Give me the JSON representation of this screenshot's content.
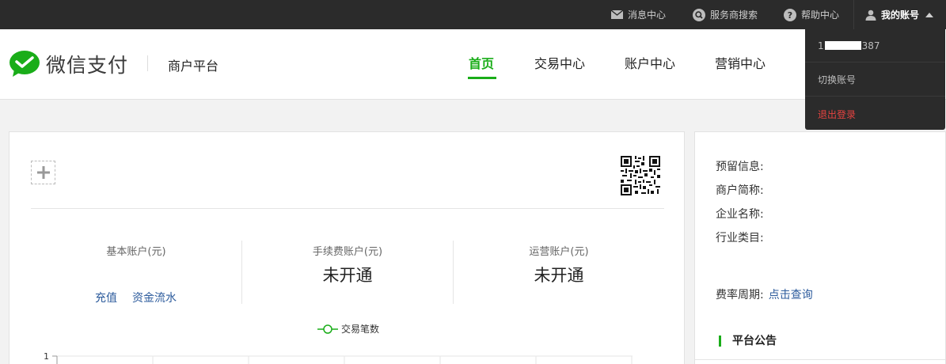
{
  "topbar": {
    "messages": "消息中心",
    "provider_search": "服务商搜索",
    "help": "帮助中心",
    "account": "我的账号"
  },
  "header": {
    "logo_text": "微信支付",
    "platform": "商户平台",
    "nav": [
      "首页",
      "交易中心",
      "账户中心",
      "营销中心"
    ],
    "active_nav": "首页"
  },
  "dropdown": {
    "account_id_prefix": "1",
    "account_id_suffix": "387",
    "switch_account": "切换账号",
    "logout": "退出登录"
  },
  "accounts": [
    {
      "title": "基本账户(元)",
      "value": ""
    },
    {
      "title": "手续费账户(元)",
      "value": "未开通"
    },
    {
      "title": "运营账户(元)",
      "value": "未开通"
    }
  ],
  "basic_links": {
    "recharge": "充值",
    "flow": "资金流水"
  },
  "chart_data": {
    "type": "line",
    "series": [
      {
        "name": "交易笔数",
        "values": []
      }
    ],
    "y_ticks": [
      "1"
    ]
  },
  "side": {
    "reserved_info": "预留信息:",
    "short_name": "商户简称:",
    "company_name": "企业名称:",
    "industry": "行业类目:",
    "rate_period": "费率周期:",
    "rate_link": "点击查询",
    "notice_title": "平台公告"
  },
  "colors": {
    "brand_green": "#1aad19",
    "link_blue": "#2c5b9c",
    "logout_red": "#e64340"
  }
}
